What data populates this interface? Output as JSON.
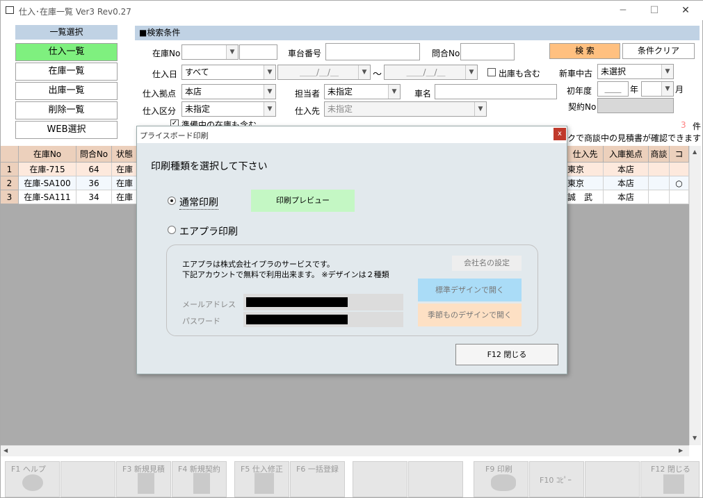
{
  "window": {
    "title": "仕入･在庫一覧 Ver3 Rev0.27",
    "minimize": "─",
    "maximize": "☐",
    "close": "✕"
  },
  "list_select": {
    "header": "一覧選択",
    "items": [
      "仕入一覧",
      "在庫一覧",
      "出庫一覧",
      "削除一覧",
      "WEB選択"
    ],
    "active_color": "#7ff07f"
  },
  "search": {
    "header": "■検索条件",
    "zaiko_no_label": "在庫No",
    "shadai_label": "車台番号",
    "toiawase_label": "問合No",
    "search_button": "検 索",
    "clear_button": "条件クリア",
    "shiire_date_label": "仕入日",
    "shiire_date_value": "すべて",
    "date_from": "＿＿/＿/＿",
    "date_to": "＿＿/＿/＿",
    "tilde": "～",
    "include_out_label": "出庫も含む",
    "new_used_label": "新車中古",
    "new_used_value": "未選択",
    "base_label": "仕入拠点",
    "base_value": "本店",
    "staff_label": "担当者",
    "staff_value": "未指定",
    "car_name_label": "車名",
    "first_year_label": "初年度",
    "first_year_value": "＿＿",
    "year_unit": "年",
    "month_unit": "月",
    "contract_label": "契約No",
    "category_label": "仕入区分",
    "category_value": "未指定",
    "supplier_label": "仕入先",
    "supplier_value": "未指定",
    "preparing_label": "準備中の在庫も含む",
    "count_value": "3",
    "count_unit": "件",
    "note": "クで商談中の見積書が確認できます"
  },
  "grid": {
    "columns": [
      "在庫No",
      "問合No",
      "状態"
    ],
    "right_columns": [
      "仕入先",
      "入庫拠点",
      "商談",
      "コ"
    ],
    "rows": [
      {
        "no": "1",
        "zaiko": "在庫-715",
        "toi": "64",
        "state": "在庫",
        "supplier": "東京",
        "base": "本店",
        "deal": "",
        "c": ""
      },
      {
        "no": "2",
        "zaiko": "在庫-SA100",
        "toi": "36",
        "state": "在庫",
        "supplier": "東京",
        "base": "本店",
        "deal": "",
        "c": "○"
      },
      {
        "no": "3",
        "zaiko": "在庫-SA111",
        "toi": "34",
        "state": "在庫",
        "supplier": "誠　武",
        "base": "本店",
        "deal": "",
        "c": ""
      }
    ]
  },
  "dialog": {
    "title": "プライスボード印刷",
    "close": "x",
    "prompt": "印刷種類を選択して下さい",
    "option_normal": "通常印刷",
    "preview_button": "印刷プレビュー",
    "option_airpra": "エアプラ印刷",
    "info_line1": "エアプラは株式会社イプラのサービスです。",
    "info_line2": "下記アカウントで無料で利用出来ます。 ※デザインは２種類",
    "company_button": "会社名の設定",
    "email_label": "メールアドレス",
    "password_label": "パスワード",
    "standard_button": "標準デザインで開く",
    "seasonal_button": "季節ものデザインで開く",
    "close_button": "F12 閉じる"
  },
  "fkeys": [
    {
      "label": "F1 ヘルプ"
    },
    {
      "label": ""
    },
    {
      "label": "F3 新規見積"
    },
    {
      "label": "F4 新規契約"
    },
    {
      "label": "F5 仕入修正"
    },
    {
      "label": "F6 一括登録"
    },
    {
      "label": ""
    },
    {
      "label": ""
    },
    {
      "label": "F9 印刷"
    },
    {
      "label": "F10 ｺﾋﾟｰ"
    },
    {
      "label": ""
    },
    {
      "label": "F12 閉じる"
    }
  ]
}
